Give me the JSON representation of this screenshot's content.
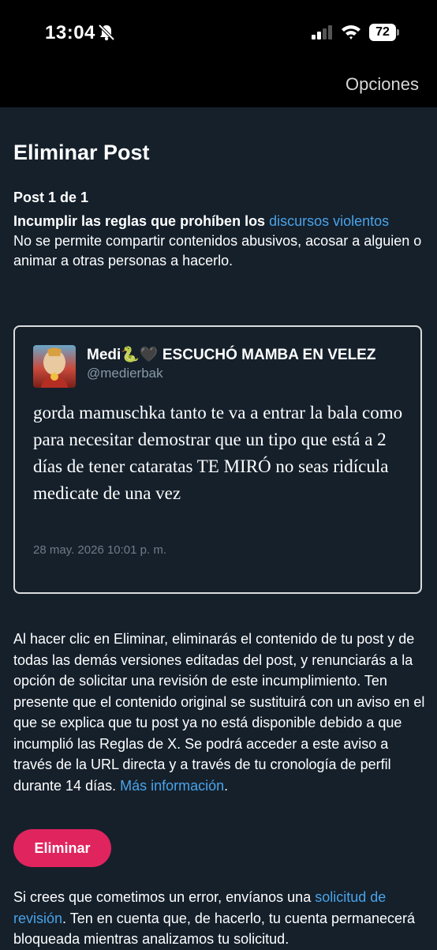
{
  "status_bar": {
    "time": "13:04",
    "battery": "72"
  },
  "header": {
    "options_label": "Opciones"
  },
  "page": {
    "title": "Eliminar Post",
    "post_count": "Post 1 de 1",
    "rule_prefix": "Incumplir las reglas que prohíben los",
    "rule_link": "discursos violentos",
    "rule_description": "No se permite compartir contenidos abusivos, acosar a alguien o animar a otras personas a hacerlo."
  },
  "tweet": {
    "display_name": "Medi🐍🖤 ESCUCHÓ MAMBA EN VELEZ",
    "handle": "@medierbak",
    "text": "gorda mamuschka tanto te va a entrar la bala como para necesitar demostrar que un tipo que está a 2 días de tener cataratas TE MIRÓ no seas ridícula medicate de una vez",
    "date": "28 may. 2026 10:01 p. m."
  },
  "notice": {
    "text": "Al hacer clic en Eliminar, eliminarás el contenido de tu post y de todas las demás versiones editadas del post, y renunciarás a la opción de solicitar una revisión de este incumplimiento. Ten presente que el contenido original se sustituirá con un aviso en el que se explica que tu post ya no está disponible debido a que incumplió las Reglas de X. Se podrá acceder a este aviso a través de la URL directa y a través de tu cronología de perfil durante 14 días.",
    "more_info_link": "Más información",
    "period": "."
  },
  "actions": {
    "delete_label": "Eliminar"
  },
  "appeal": {
    "prefix": "Si crees que cometimos un error, envíanos una",
    "link": "solicitud de revisión",
    "suffix": ". Ten en cuenta que, de hacerlo, tu cuenta permanecerá bloqueada mientras analizamos tu solicitud."
  },
  "colors": {
    "background": "#15202b",
    "link": "#4aa3e8",
    "delete_button": "#e0245e"
  }
}
